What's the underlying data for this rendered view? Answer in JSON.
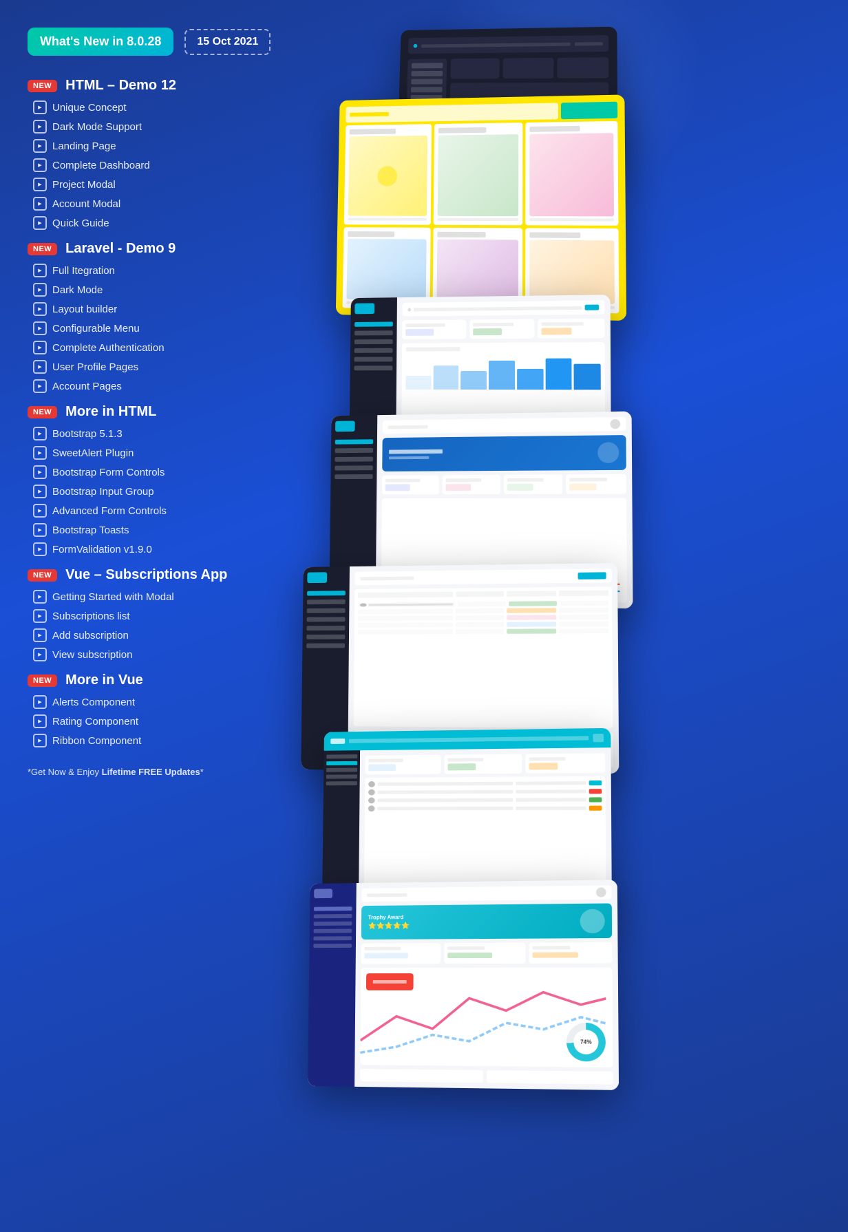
{
  "header": {
    "badge_text": "What's New in 8.0.28",
    "date_text": "15 Oct 2021"
  },
  "sections": [
    {
      "id": "html-demo-12",
      "badge": "New",
      "title": "HTML – Demo 12",
      "items": [
        "Unique Concept",
        "Dark Mode Support",
        "Landing Page",
        "Complete Dashboard",
        "Project Modal",
        "Account Modal",
        "Quick Guide"
      ]
    },
    {
      "id": "laravel-demo-9",
      "badge": "New",
      "title": "Laravel - Demo 9",
      "items": [
        "Full Itegration",
        "Dark Mode",
        "Layout builder",
        "Configurable Menu",
        "Complete Authentication",
        "User Profile Pages",
        "Account Pages"
      ]
    },
    {
      "id": "more-in-html",
      "badge": "New",
      "title": "More in HTML",
      "items": [
        "Bootstrap 5.1.3",
        "SweetAlert Plugin",
        "Bootstrap Form Controls",
        "Bootstrap Input Group",
        "Advanced Form Controls",
        "Bootstrap Toasts",
        "FormValidation v1.9.0"
      ]
    },
    {
      "id": "vue-subscriptions",
      "badge": "New",
      "title": "Vue – Subscriptions App",
      "items": [
        "Getting Started with Modal",
        "Subscriptions list",
        "Add subscription",
        "View subscription"
      ]
    },
    {
      "id": "more-in-vue",
      "badge": "New",
      "title": "More in Vue",
      "items": [
        "Alerts Component",
        "Rating Component",
        "Ribbon Component"
      ]
    }
  ],
  "footer": {
    "text_prefix": "*Get Now & Enjoy ",
    "text_bold": "Lifetime FREE Updates",
    "text_suffix": "*"
  },
  "colors": {
    "teal_gradient": "#00c9a7",
    "badge_red": "#e53935",
    "text_white": "#ffffff",
    "bg_blue": "#1a4fd6"
  }
}
